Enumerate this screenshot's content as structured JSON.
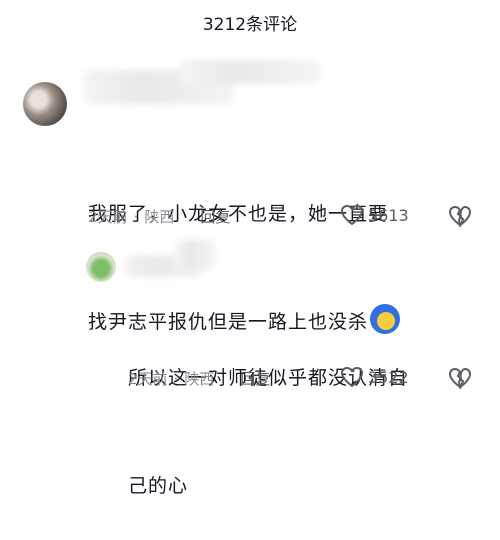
{
  "header": {
    "title": "3212条评论"
  },
  "comments": [
    {
      "text_lines": [
        "我服了，小龙女不也是，她一直要",
        "找尹志平报仇但是一路上也没杀"
      ],
      "time": "2天前",
      "location": "陕西",
      "reply_label": "回复",
      "likes": "5613",
      "emoji_icon": "blue-hair-face-emoji"
    },
    {
      "text_lines": [
        "所以这一对师徒似乎都没认清自",
        "己的心"
      ],
      "time": "2天前",
      "location": "陕西",
      "reply_label": "回复",
      "likes": "3522"
    }
  ],
  "separator": "·",
  "icons": {
    "like": "heart-outline-icon",
    "dislike": "broken-heart-icon"
  }
}
